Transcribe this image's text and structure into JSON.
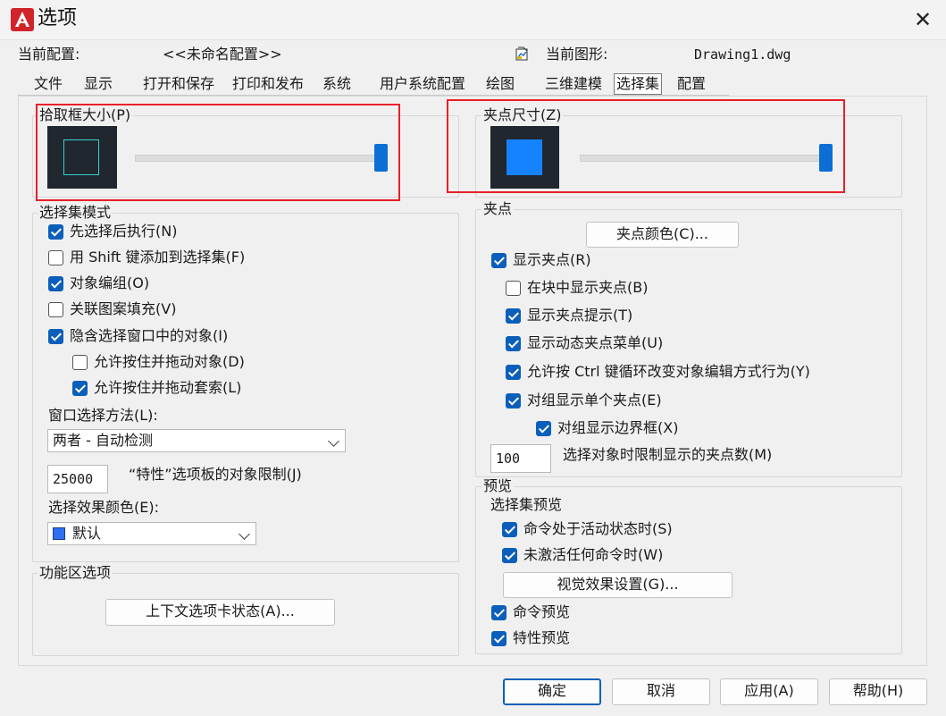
{
  "window": {
    "title": "选项",
    "close_glyph": "✕"
  },
  "config_row": {
    "profile_label": "当前配置:",
    "profile_value": "<<未命名配置>>",
    "drawing_label": "当前图形:",
    "drawing_value": "Drawing1.dwg"
  },
  "tabs": [
    {
      "label": "文件"
    },
    {
      "label": "显示"
    },
    {
      "label": "打开和保存"
    },
    {
      "label": "打印和发布"
    },
    {
      "label": "系统"
    },
    {
      "label": "用户系统配置"
    },
    {
      "label": "绘图"
    },
    {
      "label": "三维建模"
    },
    {
      "label": "选择集",
      "active": true
    },
    {
      "label": "配置"
    }
  ],
  "pickbox": {
    "label": "拾取框大小(P)",
    "slider_fraction": 1.0
  },
  "gripsize": {
    "label": "夹点尺寸(Z)",
    "slider_fraction": 1.0,
    "grip_color": "#1682ff"
  },
  "selection_modes": {
    "label": "选择集模式",
    "items": [
      {
        "label": "先选择后执行(N)",
        "checked": true
      },
      {
        "label": "用 Shift 键添加到选择集(F)",
        "checked": false
      },
      {
        "label": "对象编组(O)",
        "checked": true
      },
      {
        "label": "关联图案填充(V)",
        "checked": false
      },
      {
        "label": "隐含选择窗口中的对象(I)",
        "checked": true
      },
      {
        "label": "允许按住并拖动对象(D)",
        "checked": false
      },
      {
        "label": "允许按住并拖动套索(L)",
        "checked": true
      }
    ],
    "window_method_label": "窗口选择方法(L):",
    "window_method_value": "两者 - 自动检测",
    "object_limit_value": "25000",
    "object_limit_label": "“特性”选项板的对象限制(J)",
    "effect_color_label": "选择效果颜色(E):",
    "effect_color_value": "默认",
    "effect_color_swatch": "#2f6ff0"
  },
  "ribbon": {
    "label": "功能区选项",
    "button": "上下文选项卡状态(A)..."
  },
  "grips": {
    "label": "夹点",
    "color_button": "夹点颜色(C)...",
    "items": [
      {
        "label": "显示夹点(R)",
        "checked": true
      },
      {
        "label": "在块中显示夹点(B)",
        "checked": false
      },
      {
        "label": "显示夹点提示(T)",
        "checked": true
      },
      {
        "label": "显示动态夹点菜单(U)",
        "checked": true
      },
      {
        "label": "允许按 Ctrl 键循环改变对象编辑方式行为(Y)",
        "checked": true
      },
      {
        "label": "对组显示单个夹点(E)",
        "checked": true
      },
      {
        "label": "对组显示边界框(X)",
        "checked": true
      }
    ],
    "limit_value": "100",
    "limit_label": "选择对象时限制显示的夹点数(M)"
  },
  "preview": {
    "label": "预览",
    "sub_label": "选择集预览",
    "items": [
      {
        "label": "命令处于活动状态时(S)",
        "checked": true
      },
      {
        "label": "未激活任何命令时(W)",
        "checked": true
      }
    ],
    "visual_button": "视觉效果设置(G)...",
    "extra_items": [
      {
        "label": "命令预览",
        "checked": true
      },
      {
        "label": "特性预览",
        "checked": true
      }
    ]
  },
  "footer": {
    "ok": "确定",
    "cancel": "取消",
    "apply": "应用(A)",
    "help": "帮助(H)"
  }
}
